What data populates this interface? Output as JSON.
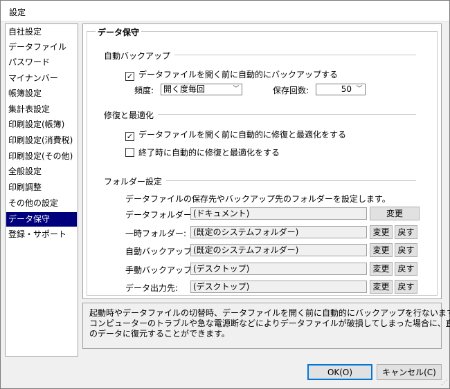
{
  "window": {
    "title": "設定"
  },
  "sidebar": {
    "items": [
      {
        "label": "自社設定"
      },
      {
        "label": "データファイル"
      },
      {
        "label": "パスワード"
      },
      {
        "label": "マイナンバー"
      },
      {
        "label": "帳簿設定"
      },
      {
        "label": "集計表設定"
      },
      {
        "label": "印刷設定(帳簿)"
      },
      {
        "label": "印刷設定(消費税)"
      },
      {
        "label": "印刷設定(その他)"
      },
      {
        "label": "全般設定"
      },
      {
        "label": "印刷調整"
      },
      {
        "label": "その他の設定"
      },
      {
        "label": "データ保守"
      },
      {
        "label": "登録・サポート"
      }
    ],
    "selected_label": "データ保守"
  },
  "panel": {
    "title": "データ保守",
    "auto_backup": {
      "section_title": "自動バックアップ",
      "checkbox_label": "データファイルを開く前に自動的にバックアップする",
      "checked": true,
      "frequency_label": "頻度:",
      "frequency_value": "開く度毎回",
      "count_label": "保存回数:",
      "count_value": "50"
    },
    "repair": {
      "section_title": "修復と最適化",
      "open_checkbox_label": "データファイルを開く前に自動的に修復と最適化をする",
      "open_checked": true,
      "exit_checkbox_label": "終了時に自動的に修復と最適化をする",
      "exit_checked": false
    },
    "folders": {
      "section_title": "フォルダー設定",
      "description": "データファイルの保存先やバックアップ先のフォルダーを設定します。",
      "rows": [
        {
          "label": "データフォルダー:",
          "value": "(ドキュメント)",
          "change": "変更",
          "reset": ""
        },
        {
          "label": "一時フォルダー:",
          "value": "(既定のシステムフォルダー)",
          "change": "変更",
          "reset": "戻す"
        },
        {
          "label": "自動バックアップ:",
          "value": "(既定のシステムフォルダー)",
          "change": "変更",
          "reset": "戻す"
        },
        {
          "label": "手動バックアップ:",
          "value": "(デスクトップ)",
          "change": "変更",
          "reset": "戻す"
        },
        {
          "label": "データ出力先:",
          "value": "(デスクトップ)",
          "change": "変更",
          "reset": "戻す"
        }
      ]
    }
  },
  "help": {
    "lines": [
      "起動時やデータファイルの切替時、データファイルを開く前に自動的にバックアップを行ないます。",
      "コンピューターのトラブルや急な電源断などによりデータファイルが破損してしまった場合に、直前",
      "のデータに復元することができます。"
    ]
  },
  "footer": {
    "ok_label": "OK(O)",
    "cancel_label": "キャンセル(C)"
  },
  "icons": {
    "checkbox_checked": "check-mark-icon",
    "combo_arrow": "chevron-down-icon"
  }
}
